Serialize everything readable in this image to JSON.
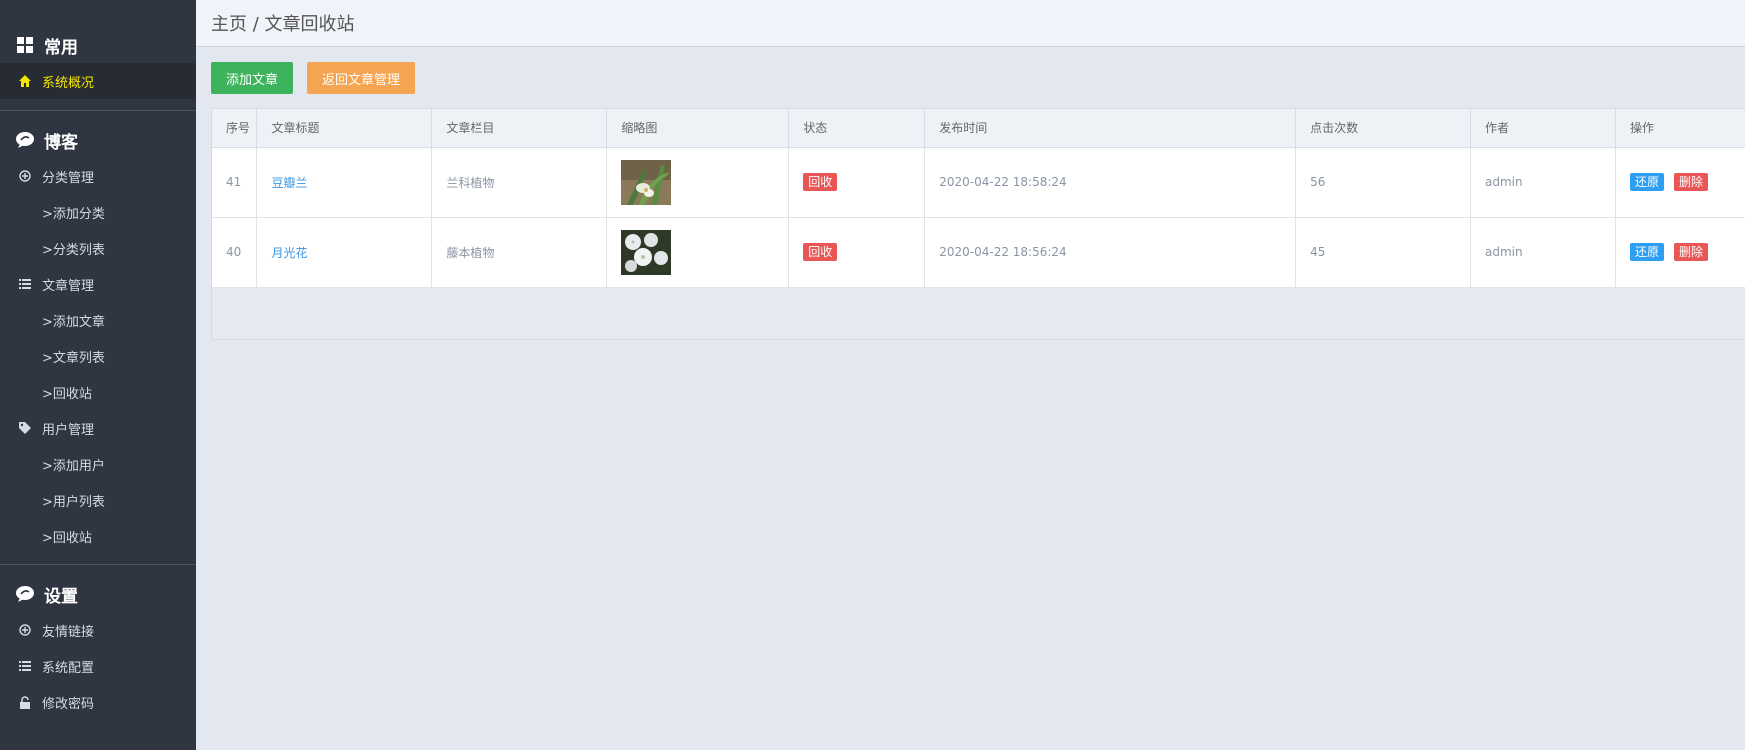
{
  "sidebar": {
    "sections": [
      {
        "title": "常用",
        "items": [
          {
            "label": "系统概况"
          }
        ]
      },
      {
        "title": "博客",
        "items": [
          {
            "label": "分类管理"
          },
          {
            "label": ">添加分类"
          },
          {
            "label": ">分类列表"
          },
          {
            "label": "文章管理"
          },
          {
            "label": ">添加文章"
          },
          {
            "label": ">文章列表"
          },
          {
            "label": ">回收站"
          },
          {
            "label": "用户管理"
          },
          {
            "label": ">添加用户"
          },
          {
            "label": ">用户列表"
          },
          {
            "label": ">回收站"
          }
        ]
      },
      {
        "title": "设置",
        "items": [
          {
            "label": "友情链接"
          },
          {
            "label": "系统配置"
          },
          {
            "label": "修改密码"
          }
        ]
      }
    ]
  },
  "header": {
    "breadcrumb": "主页 / 文章回收站"
  },
  "toolbar": {
    "add_label": "添加文章",
    "back_label": "返回文章管理",
    "colors": {
      "green": "#3cb35c",
      "orange": "#f5a451"
    }
  },
  "table": {
    "columns": [
      "序号",
      "文章标题",
      "文章栏目",
      "缩略图",
      "状态",
      "发布时间",
      "点击次数",
      "作者",
      "操作"
    ],
    "rows": [
      {
        "id": "41",
        "title": "豆瓣兰",
        "category": "兰科植物",
        "thumb": "orchid-photo",
        "status": "回收",
        "time": "2020-04-22 18:58:24",
        "clicks": "56",
        "author": "admin",
        "restore": "还原",
        "delete": "删除"
      },
      {
        "id": "40",
        "title": "月光花",
        "category": "藤本植物",
        "thumb": "moonflower-photo",
        "status": "回收",
        "time": "2020-04-22 18:56:24",
        "clicks": "45",
        "author": "admin",
        "restore": "还原",
        "delete": "删除"
      }
    ]
  }
}
